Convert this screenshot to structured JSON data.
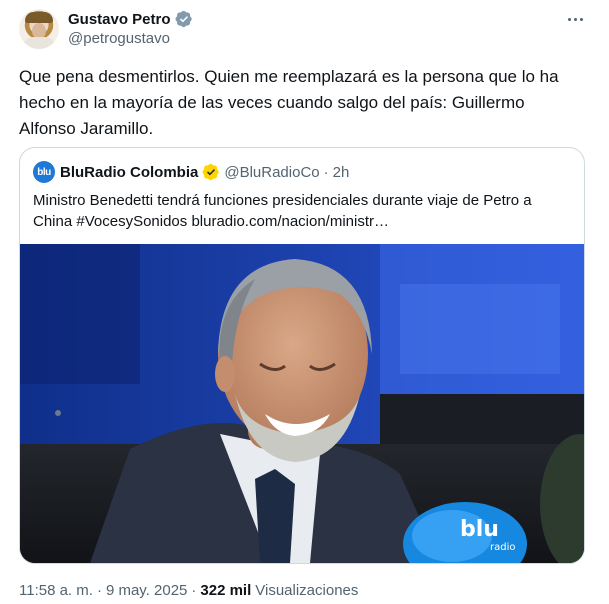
{
  "author": {
    "name": "Gustavo Petro",
    "handle": "@petrogustavo",
    "verified_color": "#829aab"
  },
  "tweet": {
    "text": "Que pena desmentirlos. Quien me reemplazará es la persona que lo ha hecho en la mayoría de las veces cuando salgo del país: Guillermo Alfonso Jaramillo."
  },
  "quoted": {
    "avatar_text": "blu",
    "name": "BluRadio Colombia",
    "handle": "@BluRadioCo",
    "separator": "·",
    "time": "2h",
    "verified_color": "#ffd400",
    "text": "Ministro Benedetti tendrá funciones presidenciales durante viaje de Petro a China #VocesySonidos bluradio.com/nacion/ministr…",
    "image": {
      "mic_label": "blu",
      "mic_sublabel": "radio"
    }
  },
  "meta": {
    "time": "11:58 a. m.",
    "separator": "·",
    "date": "9 may. 2025",
    "separator2": "·",
    "views_count": "322 mil",
    "views_label": "Visualizaciones"
  },
  "colors": {
    "text": "#0f1419",
    "secondary": "#536471",
    "border": "#cfd9de",
    "brand_blue": "#1e78d8"
  },
  "icons": [
    "verified-badge-icon",
    "more-options-icon"
  ]
}
